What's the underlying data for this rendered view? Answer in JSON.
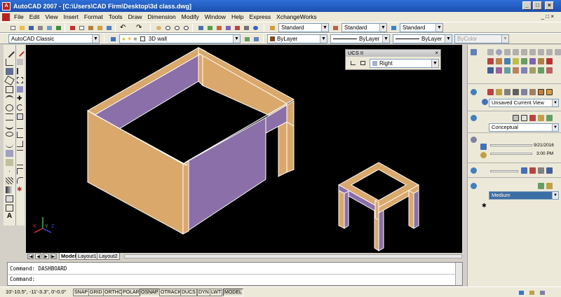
{
  "window": {
    "title": "AutoCAD 2007 - [C:\\Users\\CAD Firm\\Desktop\\3d class.dwg]",
    "icon": "autocad-logo-icon",
    "buttons": [
      "minimize-icon",
      "maximize-icon",
      "close-icon"
    ]
  },
  "menu": [
    "File",
    "Edit",
    "View",
    "Insert",
    "Format",
    "Tools",
    "Draw",
    "Dimension",
    "Modify",
    "Window",
    "Help",
    "Express",
    "XchangeWorks"
  ],
  "toolbar1": {
    "text_style": "Standard",
    "dim_style": "Standard",
    "table_style": "Standard"
  },
  "toolbar2": {
    "workspace": "AutoCAD Classic",
    "layer": "3D wall",
    "color": "ByLayer",
    "linetype": "ByLayer",
    "lineweight": "ByLayer",
    "plotstyle": "ByColor"
  },
  "ucs_panel": {
    "title": "UCS II",
    "current": "Right"
  },
  "layout_tabs": [
    "Model",
    "Layout1",
    "Layout2"
  ],
  "active_tab": "Model",
  "ucs_icon": {
    "x_label": "X",
    "y_label": "Y",
    "z_label": "Z"
  },
  "command": {
    "history": "Command: DASHBOARD",
    "prompt": "Command:"
  },
  "status": {
    "coords": "10'-10.5\", -11'-3.3\", 0'-0.0\"",
    "toggles": [
      {
        "label": "SNAP",
        "on": false
      },
      {
        "label": "GRID",
        "on": false
      },
      {
        "label": "ORTHO",
        "on": false
      },
      {
        "label": "POLAR",
        "on": false
      },
      {
        "label": "OSNAP",
        "on": true
      },
      {
        "label": "OTRACK",
        "on": false
      },
      {
        "label": "DUCS",
        "on": false
      },
      {
        "label": "DYN",
        "on": false
      },
      {
        "label": "LWT",
        "on": false
      },
      {
        "label": "MODEL",
        "on": true
      }
    ]
  },
  "dashboard": {
    "view": "Unsaved Current View",
    "visual_style": "Conceptual",
    "date": "9/21/2016",
    "time": "3:00 PM",
    "material_quality": "Medium"
  },
  "colors": {
    "wall_tan": "#d9a86a",
    "wall_purple": "#8b6fa8",
    "viewport_bg": "#000000",
    "title_blue": "#1b4fb0"
  }
}
